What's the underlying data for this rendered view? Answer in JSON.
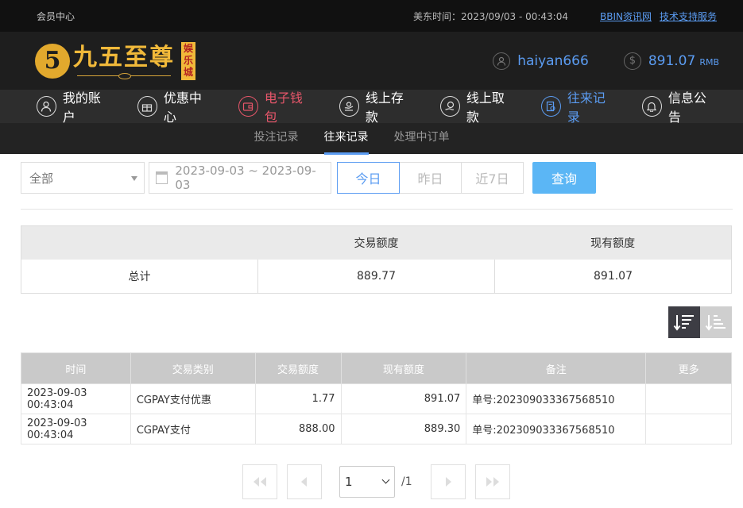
{
  "topbar": {
    "member_center": "会员中心",
    "time_label": "美东时间：2023/09/03 - 00:43:04",
    "link_news": "BBIN资讯网",
    "link_support": "技术支持服务"
  },
  "header": {
    "logo_digit": "5",
    "logo_text": "九五至尊",
    "logo_tag": [
      "娱",
      "乐",
      "城"
    ],
    "username": "haiyan666",
    "balance": "891.07",
    "currency": "RMB"
  },
  "mainnav": [
    {
      "label": "我的账户",
      "icon": "user-icon"
    },
    {
      "label": "优惠中心",
      "icon": "gift-icon"
    },
    {
      "label": "电子钱包",
      "icon": "wallet-icon"
    },
    {
      "label": "线上存款",
      "icon": "deposit-icon"
    },
    {
      "label": "线上取款",
      "icon": "withdraw-icon"
    },
    {
      "label": "往来记录",
      "icon": "record-icon"
    },
    {
      "label": "信息公告",
      "icon": "bell-icon"
    }
  ],
  "subnav": [
    {
      "label": "投注记录"
    },
    {
      "label": "往来记录"
    },
    {
      "label": "处理中订单"
    }
  ],
  "filters": {
    "type_selected": "全部",
    "date_range": "2023-09-03 ~ 2023-09-03",
    "quick": [
      "今日",
      "昨日",
      "近7日"
    ],
    "query": "查询"
  },
  "summary": {
    "headers": [
      "",
      "交易额度",
      "现有额度"
    ],
    "row": [
      "总计",
      "889.77",
      "891.07"
    ]
  },
  "table": {
    "headers": [
      "时间",
      "交易类别",
      "交易额度",
      "现有额度",
      "备注",
      "更多"
    ],
    "rows": [
      [
        "2023-09-03 00:43:04",
        "CGPAY支付优惠",
        "1.77",
        "891.07",
        "单号:202309033367568510",
        ""
      ],
      [
        "2023-09-03 00:43:04",
        "CGPAY支付",
        "888.00",
        "889.30",
        "单号:202309033367568510",
        ""
      ]
    ]
  },
  "pager": {
    "current": "1",
    "total": "/1"
  },
  "colors": {
    "accent_blue": "#5b9cf2",
    "active_red": "#e7566a",
    "logo_gold": "#f1b93a"
  }
}
